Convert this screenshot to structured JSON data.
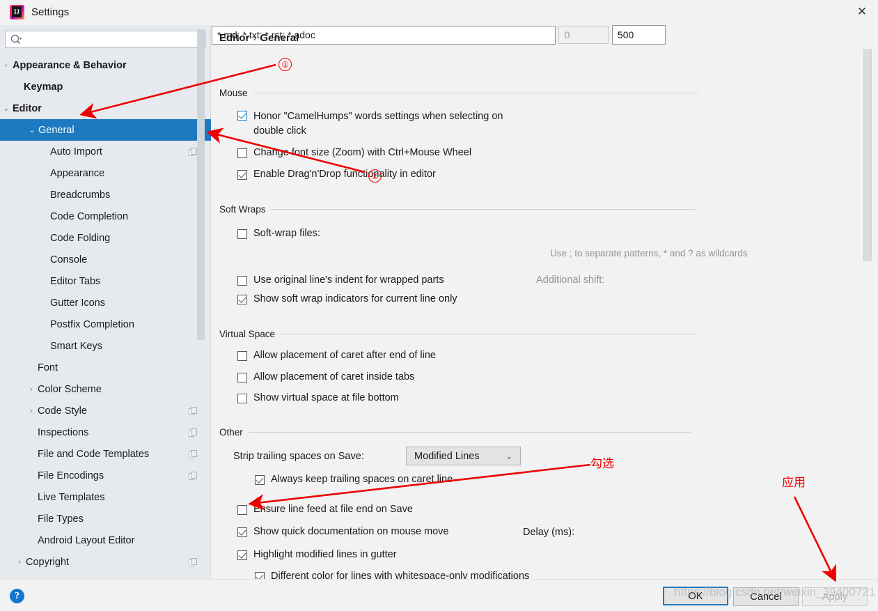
{
  "window": {
    "title": "Settings",
    "app_icon": "intellij-idea-icon",
    "close_label": "✕"
  },
  "sidebar": {
    "search": {
      "value": "",
      "placeholder": "",
      "icon": "search-icon"
    },
    "items": [
      {
        "label": "Appearance & Behavior",
        "indent": 18,
        "arrow": "›",
        "bold": true,
        "selected": false,
        "badge": false
      },
      {
        "label": "Keymap",
        "indent": 34,
        "arrow": "",
        "bold": true,
        "selected": false,
        "badge": false
      },
      {
        "label": "Editor",
        "indent": 18,
        "arrow": "⌄",
        "bold": true,
        "selected": false,
        "badge": false
      },
      {
        "label": "General",
        "indent": 55,
        "arrow": "⌄",
        "bold": false,
        "selected": true,
        "badge": false
      },
      {
        "label": "Auto Import",
        "indent": 72,
        "arrow": "",
        "bold": false,
        "selected": false,
        "badge": true
      },
      {
        "label": "Appearance",
        "indent": 72,
        "arrow": "",
        "bold": false,
        "selected": false,
        "badge": false
      },
      {
        "label": "Breadcrumbs",
        "indent": 72,
        "arrow": "",
        "bold": false,
        "selected": false,
        "badge": false
      },
      {
        "label": "Code Completion",
        "indent": 72,
        "arrow": "",
        "bold": false,
        "selected": false,
        "badge": false
      },
      {
        "label": "Code Folding",
        "indent": 72,
        "arrow": "",
        "bold": false,
        "selected": false,
        "badge": false
      },
      {
        "label": "Console",
        "indent": 72,
        "arrow": "",
        "bold": false,
        "selected": false,
        "badge": false
      },
      {
        "label": "Editor Tabs",
        "indent": 72,
        "arrow": "",
        "bold": false,
        "selected": false,
        "badge": false
      },
      {
        "label": "Gutter Icons",
        "indent": 72,
        "arrow": "",
        "bold": false,
        "selected": false,
        "badge": false
      },
      {
        "label": "Postfix Completion",
        "indent": 72,
        "arrow": "",
        "bold": false,
        "selected": false,
        "badge": false
      },
      {
        "label": "Smart Keys",
        "indent": 72,
        "arrow": "",
        "bold": false,
        "selected": false,
        "badge": false
      },
      {
        "label": "Font",
        "indent": 54,
        "arrow": "",
        "bold": false,
        "selected": false,
        "badge": false
      },
      {
        "label": "Color Scheme",
        "indent": 54,
        "arrow": "›",
        "bold": false,
        "selected": false,
        "badge": false
      },
      {
        "label": "Code Style",
        "indent": 54,
        "arrow": "›",
        "bold": false,
        "selected": false,
        "badge": true
      },
      {
        "label": "Inspections",
        "indent": 54,
        "arrow": "",
        "bold": false,
        "selected": false,
        "badge": true
      },
      {
        "label": "File and Code Templates",
        "indent": 54,
        "arrow": "",
        "bold": false,
        "selected": false,
        "badge": true
      },
      {
        "label": "File Encodings",
        "indent": 54,
        "arrow": "",
        "bold": false,
        "selected": false,
        "badge": true
      },
      {
        "label": "Live Templates",
        "indent": 54,
        "arrow": "",
        "bold": false,
        "selected": false,
        "badge": false
      },
      {
        "label": "File Types",
        "indent": 54,
        "arrow": "",
        "bold": false,
        "selected": false,
        "badge": false
      },
      {
        "label": "Android Layout Editor",
        "indent": 54,
        "arrow": "",
        "bold": false,
        "selected": false,
        "badge": false
      },
      {
        "label": "Copyright",
        "indent": 37,
        "arrow": "›",
        "bold": false,
        "selected": false,
        "badge": true
      }
    ]
  },
  "main": {
    "breadcrumb": {
      "root": "Editor",
      "separator": "›",
      "leaf": "General"
    },
    "groups": {
      "mouse": "Mouse",
      "soft_wraps": "Soft Wraps",
      "virtual_space": "Virtual Space",
      "other": "Other"
    },
    "mouse_options": [
      {
        "label": "Honor \"CamelHumps\" words settings when selecting on double click",
        "checked": true,
        "focused": true
      },
      {
        "label": "Change font size (Zoom) with Ctrl+Mouse Wheel",
        "checked": false,
        "focused": false
      },
      {
        "label": "Enable Drag'n'Drop functionality in editor",
        "checked": true,
        "focused": false
      }
    ],
    "soft_wrap": {
      "files_label": "Soft-wrap files:",
      "files_checked": false,
      "files_value": "*.md; *.txt; *.rst; *.adoc",
      "hint": "Use ; to separate patterns, * and ? as wildcards",
      "use_indent_label": "Use original line's indent for wrapped parts",
      "use_indent_checked": false,
      "additional_shift_label": "Additional shift:",
      "additional_shift_value": "0",
      "indicators_label": "Show soft wrap indicators for current line only",
      "indicators_checked": true
    },
    "virtual_space_options": [
      {
        "label": "Allow placement of caret after end of line",
        "checked": false
      },
      {
        "label": "Allow placement of caret inside tabs",
        "checked": false
      },
      {
        "label": "Show virtual space at file bottom",
        "checked": false
      }
    ],
    "other": {
      "strip_label": "Strip trailing spaces on Save:",
      "strip_value": "Modified Lines",
      "strip_chevron": "⌄",
      "keep_trailing_label": "Always keep trailing spaces on caret line",
      "keep_trailing_checked": true,
      "ensure_linefeed_label": "Ensure line feed at file end on Save",
      "ensure_linefeed_checked": false,
      "quick_doc_label": "Show quick documentation on mouse move",
      "quick_doc_checked": true,
      "delay_label": "Delay (ms):",
      "delay_value": "500",
      "highlight_label": "Highlight modified lines in gutter",
      "highlight_checked": true,
      "diff_color_label": "Different color for lines with whitespace-only modifications",
      "diff_color_checked": true
    }
  },
  "footer": {
    "help_label": "?",
    "ok_label": "OK",
    "cancel_label": "Cancel",
    "apply_label": "Apply"
  },
  "annotations": {
    "marker1": "①",
    "marker2": "②",
    "checkbox_note": "勾选",
    "apply_note": "应用",
    "watermark": "https://blog.csdn.net/weixin_39400721"
  },
  "colors": {
    "accent": "#1d7ac0",
    "annotation": "#ee0000",
    "sidebar_bg": "#e6eaee",
    "panel_bg": "#f2f2f2",
    "help_blue": "#1378cd"
  }
}
